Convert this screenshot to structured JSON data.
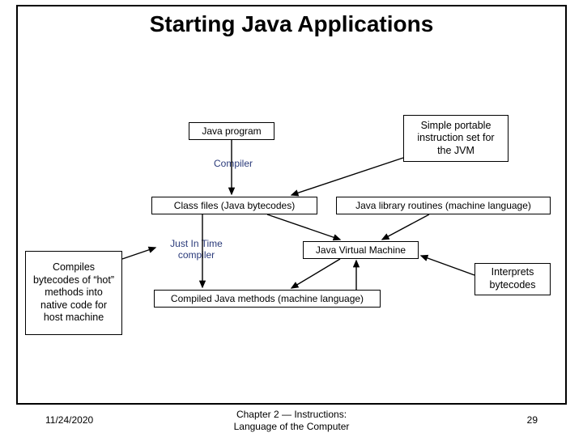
{
  "title": "Starting Java Applications",
  "diagram": {
    "java_program": "Java program",
    "compiler": "Compiler",
    "class_files": "Class files (Java bytecodes)",
    "library": "Java library routines (machine language)",
    "jit": "Just In Time compiler",
    "jvm": "Java Virtual Machine",
    "compiled_methods": "Compiled Java methods (machine language)"
  },
  "callouts": {
    "jvm_iset": "Simple portable instruction set for the JVM",
    "jit_desc": "Compiles bytecodes of “hot” methods into native code for host machine",
    "jvm_desc": "Interprets bytecodes"
  },
  "footer": {
    "date": "11/24/2020",
    "center": "Chapter 2 — Instructions: Language of the Computer",
    "page": "29"
  }
}
